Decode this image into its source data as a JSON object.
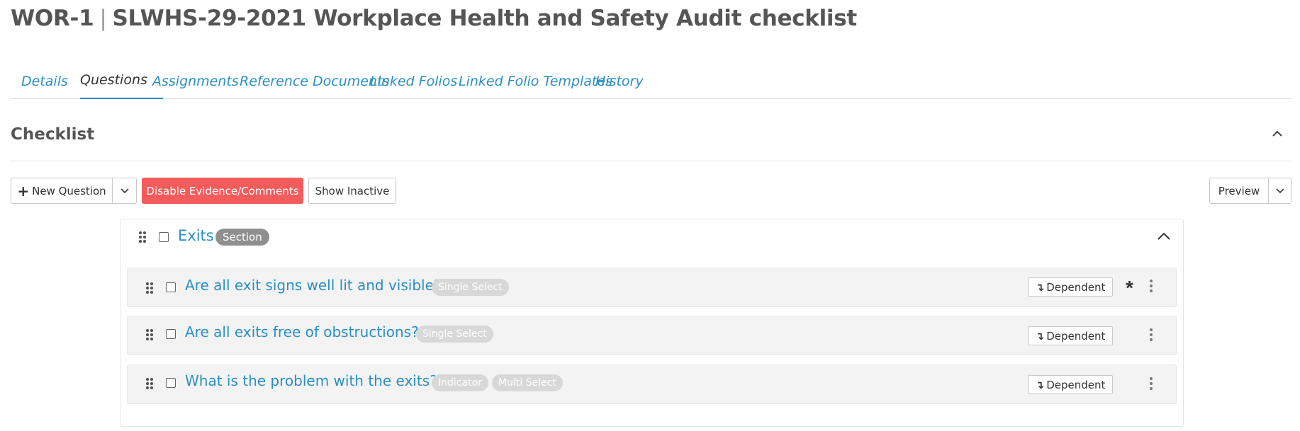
{
  "page": {
    "code": "WOR-1",
    "separator": "|",
    "title": "SLWHS-29-2021 Workplace Health and Safety Audit checklist"
  },
  "tabs": [
    {
      "label": "Details"
    },
    {
      "label": "Questions",
      "active": true
    },
    {
      "label": "Assignments"
    },
    {
      "label": "Reference Documents"
    },
    {
      "label": "Linked Folios"
    },
    {
      "label": "Linked Folio Templates"
    },
    {
      "label": "History"
    }
  ],
  "checklist": {
    "heading": "Checklist",
    "collapse_icon": "chevron-up-icon"
  },
  "toolbar": {
    "new_question_label": "New Question",
    "disable_evidence_label": "Disable Evidence/Comments",
    "show_inactive_label": "Show Inactive",
    "preview_label": "Preview"
  },
  "section": {
    "name": "Exits",
    "badge": "Section",
    "questions": [
      {
        "text": "Are all exit signs well lit and visible?",
        "badges": [
          "Single Select"
        ],
        "dependent_label": "Dependent",
        "required": true
      },
      {
        "text": "Are all exits free of obstructions?",
        "badges": [
          "Single Select"
        ],
        "dependent_label": "Dependent",
        "required": false
      },
      {
        "text": "What is the problem with the exits?",
        "badges": [
          "Indicator",
          "Multi Select"
        ],
        "dependent_label": "Dependent",
        "required": false
      }
    ]
  },
  "colors": {
    "accent": "#2a8fc4",
    "danger": "#f45b5b",
    "section_badge": "#8f8f8f",
    "question_badge": "#d8d8d8",
    "row_background": "#f3f3f3"
  }
}
